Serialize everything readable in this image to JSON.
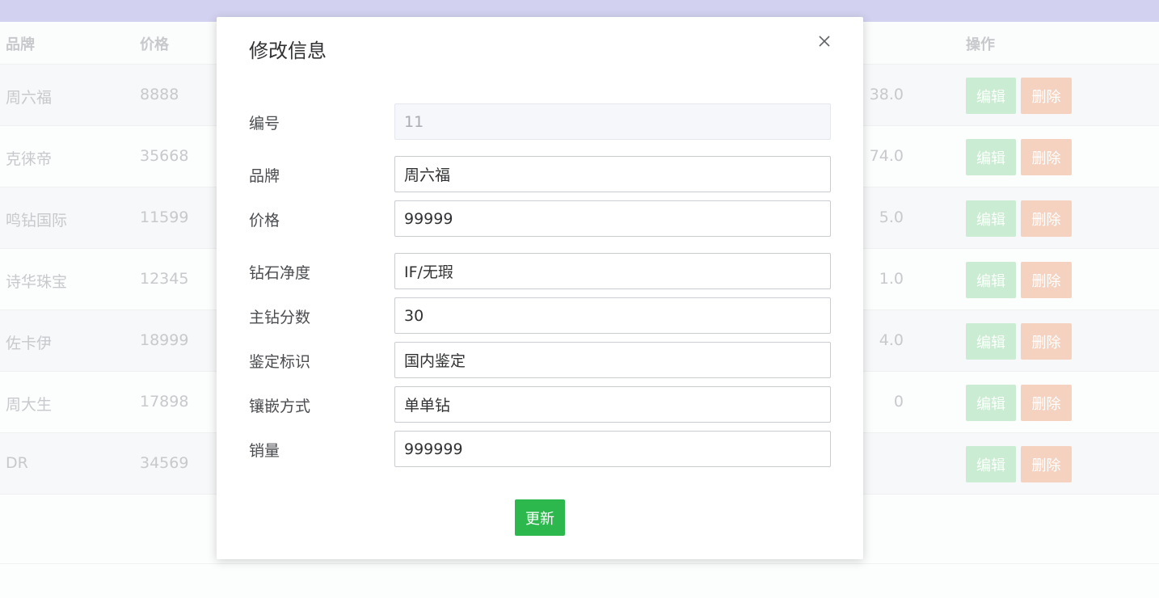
{
  "table": {
    "headers": {
      "brand": "品牌",
      "price": "价格",
      "actions": "操作"
    },
    "edit_label": "编辑",
    "delete_label": "删除",
    "rows": [
      {
        "brand": "周六福",
        "price": "8888",
        "sales": "38.0"
      },
      {
        "brand": "克徕帝",
        "price": "35668",
        "sales": "74.0"
      },
      {
        "brand": "鸣钻国际",
        "price": "11599",
        "sales": "5.0"
      },
      {
        "brand": "诗华珠宝",
        "price": "12345",
        "sales": "1.0"
      },
      {
        "brand": "佐卡伊",
        "price": "18999",
        "sales": "4.0"
      },
      {
        "brand": "周大生",
        "price": "17898",
        "sales": "0"
      },
      {
        "brand": "DR",
        "price": "34569",
        "sales": ""
      }
    ]
  },
  "modal": {
    "title": "修改信息",
    "fields": [
      {
        "label": "编号",
        "value": "11",
        "disabled": true
      },
      {
        "label": "品牌",
        "value": "周六福"
      },
      {
        "label": "价格",
        "value": "99999"
      },
      {
        "label": "钻石净度",
        "value": "IF/无瑕"
      },
      {
        "label": "主钻分数",
        "value": "30"
      },
      {
        "label": "鉴定标识",
        "value": "国内鉴定"
      },
      {
        "label": "镶嵌方式",
        "value": "单单钻"
      },
      {
        "label": "销量",
        "value": "999999"
      }
    ],
    "submit_label": "更新"
  },
  "colors": {
    "top_bar": "#d2d2f0",
    "edit_button": "#c9ecd2",
    "delete_button": "#f5d2bf",
    "update_button": "#2db84d"
  },
  "icons": {
    "close": "close-icon"
  }
}
